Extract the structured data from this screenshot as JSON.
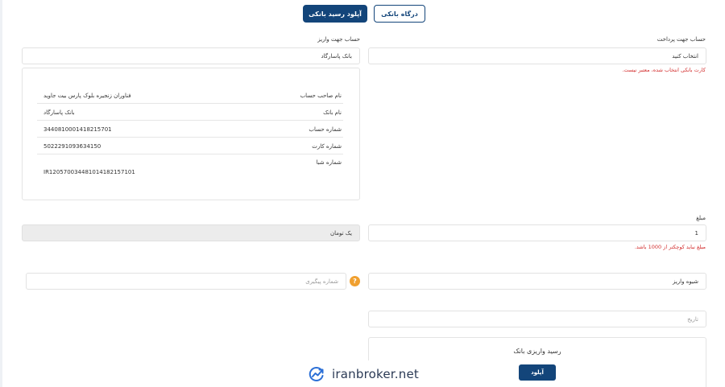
{
  "tabs": {
    "upload_receipt": "آپلود رسید بانکی",
    "bank_gateway": "درگاه بانکی"
  },
  "payment_account": {
    "label": "حساب جهت پرداخت",
    "value": "انتخاب کنید",
    "error": "کارت بانکی انتخاب شده، معتبر نیست."
  },
  "deposit_account": {
    "label": "حساب جهت واریز",
    "value": "بانک پاسارگاد"
  },
  "account_details": [
    {
      "key": "نام صاحب حساب",
      "value": "فناوران زنجیره بلوک پارس بیت جاوید"
    },
    {
      "key": "نام بانک",
      "value": "بانک پاسارگاد"
    },
    {
      "key": "شماره حساب",
      "value": "3440810001418215701"
    },
    {
      "key": "شماره کارت",
      "value": "5022291093634150"
    },
    {
      "key": "شماره شبا",
      "value": "IR120570034481014182157101"
    }
  ],
  "amount": {
    "label": "مبلغ",
    "value": "1",
    "words": "یک تومان",
    "error": "مبلغ نباید کوچکتر از 1000 باشد."
  },
  "tracking": {
    "placeholder": "شماره پیگیری",
    "help_symbol": "?"
  },
  "deposit_method": {
    "value": "شیوه واریز"
  },
  "date": {
    "placeholder": "تاریخ"
  },
  "receipt": {
    "title": "رسید واریزی بانک",
    "upload_label": "آپلود"
  },
  "watermark": {
    "text": "iranbroker.net"
  },
  "colors": {
    "primary": "#13457a",
    "error": "#d32f2f",
    "help": "#f0a030"
  }
}
